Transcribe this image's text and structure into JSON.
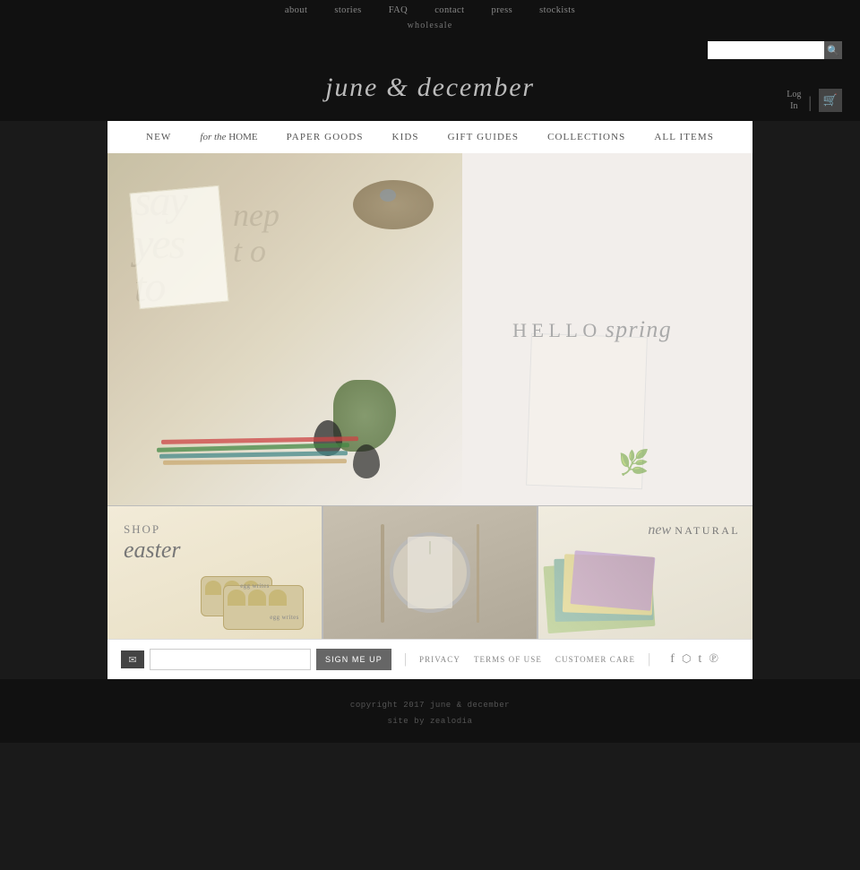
{
  "topNav": {
    "links": [
      {
        "label": "about",
        "href": "#"
      },
      {
        "label": "stories",
        "href": "#"
      },
      {
        "label": "FAQ",
        "href": "#"
      },
      {
        "label": "contact",
        "href": "#"
      },
      {
        "label": "press",
        "href": "#"
      },
      {
        "label": "stockists",
        "href": "#"
      }
    ],
    "wholesale": "wholesale"
  },
  "header": {
    "searchPlaceholder": "",
    "searchBtn": "🔍",
    "loginLabel": "Log\nIn",
    "cartIcon": "🛒",
    "siteTitle": "june & december"
  },
  "mainNav": {
    "links": [
      {
        "label": "NEW",
        "href": "#",
        "style": "normal"
      },
      {
        "label": "for the HOME",
        "href": "#",
        "style": "mixed"
      },
      {
        "label": "PAPER GOODS",
        "href": "#",
        "style": "normal"
      },
      {
        "label": "KIDS",
        "href": "#",
        "style": "normal"
      },
      {
        "label": "GIFT GUIDES",
        "href": "#",
        "style": "normal"
      },
      {
        "label": "COLLECTIONS",
        "href": "#",
        "style": "normal"
      },
      {
        "label": "ALL ITEMS",
        "href": "#",
        "style": "normal"
      }
    ]
  },
  "hero": {
    "helloText": "HELLO",
    "springText": "spring",
    "imageAlt": "Spring styled flatlay with botanicals and eggs"
  },
  "cards": [
    {
      "id": "easter",
      "shopLabel": "SHOP",
      "featureLabel": "easter",
      "imageAlt": "Easter egg cartons"
    },
    {
      "id": "table",
      "imageAlt": "Elegant table setting with herbs"
    },
    {
      "id": "natural",
      "newLabel": "new",
      "naturalLabel": "NATURAL",
      "imageAlt": "Natural fabric swatches"
    }
  ],
  "footer": {
    "emailPlaceholder": "",
    "signUpBtn": "SIGN ME UP",
    "links": [
      {
        "label": "PRIVACY",
        "href": "#"
      },
      {
        "label": "TERMS OF USE",
        "href": "#"
      },
      {
        "label": "CUSTOMER CARE",
        "href": "#"
      }
    ],
    "socialLinks": [
      {
        "icon": "f",
        "label": "facebook",
        "href": "#"
      },
      {
        "icon": "📷",
        "label": "instagram",
        "href": "#"
      },
      {
        "icon": "t",
        "label": "twitter",
        "href": "#"
      },
      {
        "icon": "p",
        "label": "pinterest",
        "href": "#"
      }
    ],
    "copyright": "copyright 2017 june & december",
    "siteBy": "site by zealodia"
  }
}
